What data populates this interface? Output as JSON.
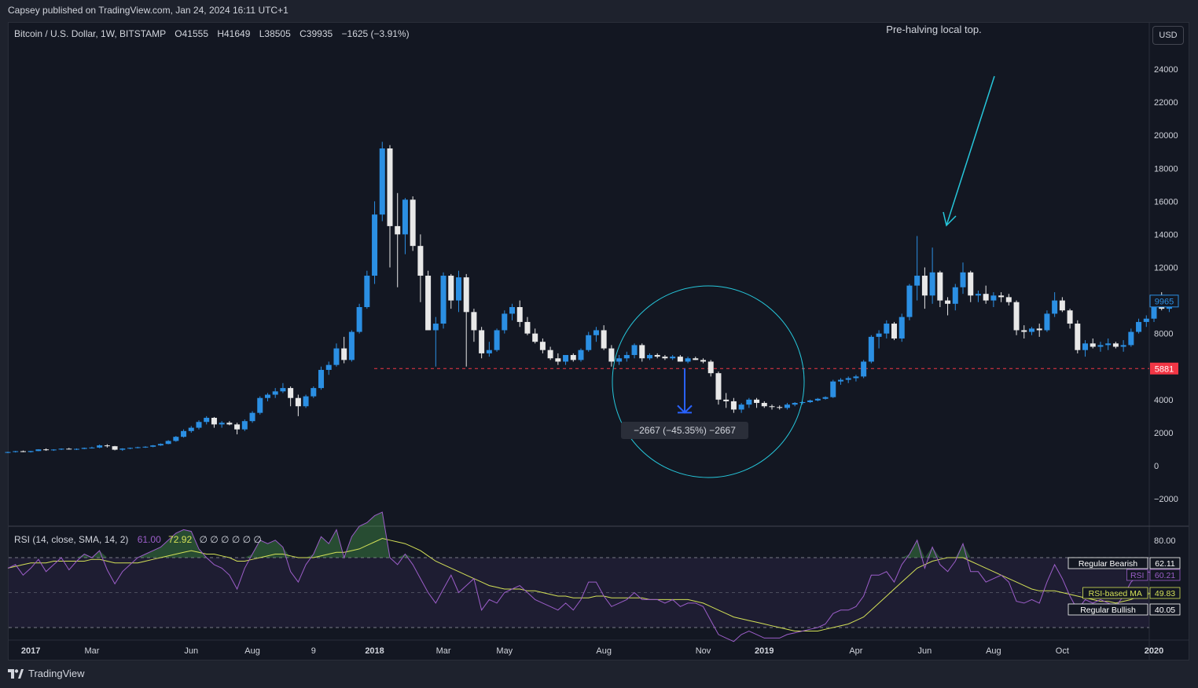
{
  "header": {
    "publisher": "Capsey published on TradingView.com, Jan 24, 2024 16:11 UTC+1"
  },
  "legend": {
    "symbol": "Bitcoin / U.S. Dollar, 1W, BITSTAMP",
    "open": "O41555",
    "high": "H41649",
    "low": "L38505",
    "close": "C39935",
    "change": "−1625 (−3.91%)"
  },
  "currency_button": "USD",
  "annotations": {
    "note": "Pre-halving local top.",
    "measure": "−2667 (−45.35%) −2667",
    "support_level": "5881",
    "last_price": "9965"
  },
  "rsi": {
    "title": "RSI (14, close, SMA, 14, 2)",
    "value": "61.00",
    "ma_value": "72.92",
    "empty_markers": "∅ ∅ ∅ ∅ ∅ ∅",
    "labels": [
      {
        "name": "Regular Bearish",
        "value": "62.11"
      },
      {
        "name": "RSI",
        "value": "60.21"
      },
      {
        "name": "RSI-based MA",
        "value": "49.83"
      },
      {
        "name": "Regular Bullish",
        "value": "40.05"
      }
    ],
    "axis_top": "80.00"
  },
  "footer": {
    "brand": "TradingView"
  },
  "colors": {
    "up": "#2b8fe3",
    "down": "#e8e8e8",
    "background": "#131722",
    "annotation": "#26c6da",
    "support": "#f23645",
    "rsi": "#9c5ec9",
    "rsi_ma": "#d4e157",
    "measure_arrow": "#2962ff"
  },
  "chart_data": {
    "type": "candlestick",
    "title": "Bitcoin / U.S. Dollar, 1W, BITSTAMP",
    "price_axis": {
      "ticks": [
        24000,
        22000,
        20000,
        18000,
        16000,
        14000,
        12000,
        10000,
        8000,
        6000,
        4000,
        2000,
        0,
        -2000
      ],
      "tick_labels": [
        "24000",
        "22000",
        "20000",
        "18000",
        "16000",
        "14000",
        "12000",
        "",
        "8000",
        "",
        "4000",
        "2000",
        "0",
        "−2000"
      ]
    },
    "time_axis": {
      "labels": [
        "2017",
        "Mar",
        "Jun",
        "Aug",
        "9",
        "2018",
        "Mar",
        "May",
        "Aug",
        "Nov",
        "2019",
        "Apr",
        "Jun",
        "Aug",
        "Oct",
        "2020"
      ],
      "label_week_index": [
        3,
        11,
        24,
        32,
        40,
        48,
        57,
        65,
        78,
        91,
        99,
        111,
        120,
        129,
        138,
        150
      ]
    },
    "ohlc": [
      [
        780,
        850,
        760,
        830
      ],
      [
        830,
        900,
        800,
        880
      ],
      [
        880,
        920,
        820,
        830
      ],
      [
        830,
        900,
        800,
        890
      ],
      [
        890,
        1000,
        880,
        990
      ],
      [
        990,
        1050,
        900,
        940
      ],
      [
        940,
        1000,
        900,
        980
      ],
      [
        980,
        1050,
        950,
        1030
      ],
      [
        1030,
        1080,
        980,
        1000
      ],
      [
        1000,
        1050,
        950,
        1020
      ],
      [
        1020,
        1100,
        1000,
        1080
      ],
      [
        1080,
        1150,
        1040,
        1100
      ],
      [
        1100,
        1280,
        1060,
        1230
      ],
      [
        1230,
        1300,
        1100,
        1180
      ],
      [
        1180,
        1200,
        930,
        970
      ],
      [
        970,
        1060,
        900,
        1040
      ],
      [
        1040,
        1100,
        1000,
        1080
      ],
      [
        1080,
        1150,
        1050,
        1120
      ],
      [
        1120,
        1180,
        1080,
        1150
      ],
      [
        1150,
        1250,
        1120,
        1230
      ],
      [
        1230,
        1350,
        1200,
        1320
      ],
      [
        1320,
        1550,
        1300,
        1500
      ],
      [
        1500,
        1800,
        1450,
        1750
      ],
      [
        1750,
        2200,
        1700,
        2100
      ],
      [
        2100,
        2400,
        2000,
        2300
      ],
      [
        2300,
        2750,
        2200,
        2650
      ],
      [
        2650,
        3000,
        2500,
        2900
      ],
      [
        2900,
        2950,
        2300,
        2500
      ],
      [
        2500,
        2700,
        2300,
        2600
      ],
      [
        2600,
        2700,
        2450,
        2500
      ],
      [
        2500,
        2600,
        1900,
        2200
      ],
      [
        2200,
        2800,
        2100,
        2700
      ],
      [
        2700,
        3300,
        2600,
        3200
      ],
      [
        3200,
        4200,
        3100,
        4100
      ],
      [
        4100,
        4400,
        3900,
        4300
      ],
      [
        4300,
        4700,
        4100,
        4500
      ],
      [
        4500,
        5000,
        4400,
        4700
      ],
      [
        4700,
        4800,
        3600,
        4100
      ],
      [
        4100,
        4300,
        3000,
        3600
      ],
      [
        3600,
        4300,
        3500,
        4200
      ],
      [
        4200,
        4800,
        4100,
        4700
      ],
      [
        4700,
        6000,
        4600,
        5800
      ],
      [
        5800,
        6300,
        5500,
        6100
      ],
      [
        6100,
        7400,
        6000,
        7100
      ],
      [
        7100,
        7800,
        6200,
        6400
      ],
      [
        6400,
        8200,
        6300,
        8100
      ],
      [
        8100,
        9800,
        8000,
        9600
      ],
      [
        9600,
        11800,
        9500,
        11500
      ],
      [
        11500,
        16000,
        11000,
        15200
      ],
      [
        15200,
        19600,
        14800,
        19200
      ],
      [
        19200,
        19400,
        12000,
        14500
      ],
      [
        14500,
        16500,
        10800,
        14000
      ],
      [
        14000,
        16200,
        12800,
        16100
      ],
      [
        16100,
        16300,
        13000,
        13300
      ],
      [
        13300,
        14000,
        9900,
        11500
      ],
      [
        11500,
        11800,
        9000,
        8200
      ],
      [
        8200,
        9000,
        6000,
        8600
      ],
      [
        8600,
        11700,
        8300,
        11500
      ],
      [
        11500,
        11600,
        9500,
        10000
      ],
      [
        10000,
        11800,
        9300,
        11400
      ],
      [
        11400,
        11600,
        6000,
        9300
      ],
      [
        9300,
        9500,
        7500,
        8200
      ],
      [
        8200,
        8400,
        6500,
        6800
      ],
      [
        6800,
        7500,
        6600,
        7000
      ],
      [
        7000,
        8300,
        6900,
        8200
      ],
      [
        8200,
        9400,
        8000,
        9200
      ],
      [
        9200,
        9800,
        8800,
        9600
      ],
      [
        9600,
        10000,
        8400,
        8700
      ],
      [
        8700,
        9000,
        7900,
        8000
      ],
      [
        8000,
        8300,
        7400,
        7500
      ],
      [
        7500,
        7700,
        6800,
        7000
      ],
      [
        7000,
        7200,
        6400,
        6500
      ],
      [
        6500,
        6800,
        6100,
        6300
      ],
      [
        6300,
        6700,
        6100,
        6700
      ],
      [
        6700,
        6800,
        6300,
        6400
      ],
      [
        6400,
        7100,
        6300,
        7000
      ],
      [
        7000,
        8100,
        6900,
        7900
      ],
      [
        7900,
        8400,
        7500,
        8200
      ],
      [
        8200,
        8500,
        7000,
        7100
      ],
      [
        7100,
        7300,
        6000,
        6300
      ],
      [
        6300,
        6700,
        6100,
        6500
      ],
      [
        6500,
        6900,
        6300,
        6700
      ],
      [
        6700,
        7400,
        6500,
        7300
      ],
      [
        7300,
        7400,
        6300,
        6500
      ],
      [
        6500,
        6800,
        6400,
        6700
      ],
      [
        6700,
        6800,
        6500,
        6600
      ],
      [
        6600,
        6700,
        6400,
        6500
      ],
      [
        6500,
        6700,
        6400,
        6600
      ],
      [
        6600,
        6700,
        6300,
        6300
      ],
      [
        6300,
        6600,
        6200,
        6500
      ],
      [
        6500,
        6600,
        6400,
        6400
      ],
      [
        6400,
        6500,
        6200,
        6300
      ],
      [
        6300,
        6400,
        5400,
        5600
      ],
      [
        5600,
        5700,
        3700,
        4000
      ],
      [
        4000,
        4400,
        3500,
        3900
      ],
      [
        3900,
        4100,
        3200,
        3400
      ],
      [
        3400,
        3800,
        3200,
        3700
      ],
      [
        3700,
        4100,
        3500,
        4000
      ],
      [
        4000,
        4100,
        3500,
        3800
      ],
      [
        3800,
        3900,
        3500,
        3600
      ],
      [
        3600,
        3700,
        3400,
        3550
      ],
      [
        3550,
        3650,
        3400,
        3500
      ],
      [
        3500,
        3800,
        3400,
        3700
      ],
      [
        3700,
        3850,
        3600,
        3800
      ],
      [
        3800,
        3900,
        3700,
        3850
      ],
      [
        3850,
        4000,
        3800,
        3950
      ],
      [
        3950,
        4100,
        3900,
        4050
      ],
      [
        4050,
        4200,
        4000,
        4150
      ],
      [
        4150,
        5200,
        4100,
        5100
      ],
      [
        5100,
        5300,
        4900,
        5200
      ],
      [
        5200,
        5400,
        5000,
        5300
      ],
      [
        5300,
        5500,
        5100,
        5400
      ],
      [
        5400,
        6400,
        5300,
        6300
      ],
      [
        6300,
        7900,
        6200,
        7800
      ],
      [
        7800,
        8200,
        7100,
        8000
      ],
      [
        8000,
        8800,
        7700,
        8600
      ],
      [
        8600,
        8700,
        7600,
        7700
      ],
      [
        7700,
        9200,
        7500,
        9000
      ],
      [
        9000,
        11000,
        8800,
        10900
      ],
      [
        10900,
        13900,
        10000,
        11500
      ],
      [
        11500,
        12000,
        9500,
        10300
      ],
      [
        10300,
        13200,
        9800,
        11700
      ],
      [
        11700,
        11800,
        9600,
        10000
      ],
      [
        10000,
        10200,
        9100,
        9800
      ],
      [
        9800,
        11000,
        9400,
        10800
      ],
      [
        10800,
        12300,
        10400,
        11700
      ],
      [
        11700,
        11800,
        9900,
        10300
      ],
      [
        10300,
        10600,
        9900,
        10400
      ],
      [
        10400,
        10900,
        9800,
        10000
      ],
      [
        10000,
        10500,
        9600,
        10300
      ],
      [
        10300,
        10500,
        9900,
        10200
      ],
      [
        10200,
        10400,
        9700,
        9900
      ],
      [
        9900,
        10000,
        7900,
        8200
      ],
      [
        8200,
        8500,
        7700,
        8100
      ],
      [
        8100,
        8400,
        7900,
        8300
      ],
      [
        8300,
        8600,
        7800,
        8200
      ],
      [
        8200,
        9400,
        8100,
        9200
      ],
      [
        9200,
        10500,
        9000,
        10000
      ],
      [
        10000,
        10200,
        9300,
        9400
      ],
      [
        9400,
        9500,
        8300,
        8600
      ],
      [
        8600,
        8800,
        6800,
        7000
      ],
      [
        7000,
        7600,
        6600,
        7400
      ],
      [
        7400,
        7700,
        7100,
        7200
      ],
      [
        7200,
        7500,
        6900,
        7300
      ],
      [
        7300,
        7700,
        7000,
        7400
      ],
      [
        7400,
        7500,
        7100,
        7200
      ],
      [
        7200,
        7600,
        6900,
        7300
      ],
      [
        7300,
        8300,
        7200,
        8100
      ],
      [
        8100,
        8900,
        8000,
        8700
      ],
      [
        8700,
        9100,
        8400,
        8900
      ],
      [
        8900,
        9700,
        8700,
        9600
      ],
      [
        9600,
        10500,
        9400,
        9500
      ],
      [
        9500,
        10100,
        9300,
        9965
      ]
    ],
    "rsi_series": [
      64,
      66,
      60,
      64,
      69,
      62,
      66,
      70,
      63,
      68,
      72,
      70,
      74,
      63,
      55,
      62,
      66,
      70,
      72,
      74,
      76,
      80,
      84,
      86,
      85,
      75,
      70,
      66,
      64,
      60,
      52,
      64,
      72,
      80,
      78,
      80,
      76,
      62,
      56,
      66,
      72,
      82,
      78,
      86,
      70,
      82,
      88,
      90,
      94,
      96,
      70,
      66,
      72,
      66,
      58,
      50,
      44,
      52,
      60,
      50,
      54,
      58,
      40,
      46,
      44,
      50,
      52,
      54,
      50,
      46,
      44,
      42,
      40,
      44,
      40,
      46,
      56,
      56,
      48,
      42,
      44,
      46,
      50,
      46,
      46,
      46,
      44,
      46,
      42,
      44,
      44,
      42,
      34,
      26,
      24,
      22,
      26,
      28,
      26,
      24,
      24,
      24,
      26,
      27,
      28,
      29,
      30,
      32,
      38,
      40,
      40,
      42,
      48,
      60,
      60,
      62,
      56,
      66,
      72,
      80,
      64,
      76,
      66,
      62,
      68,
      78,
      62,
      62,
      56,
      58,
      60,
      56,
      45,
      44,
      46,
      44,
      56,
      66,
      58,
      48,
      40,
      46,
      44,
      46,
      44,
      42,
      48,
      56,
      60,
      62,
      61
    ],
    "rsi_ma_series": [
      64,
      65,
      66,
      67,
      67,
      67,
      68,
      68,
      68,
      68,
      68,
      69,
      69,
      68,
      67,
      67,
      67,
      67,
      68,
      69,
      70,
      71,
      72,
      73,
      74,
      73,
      72,
      72,
      71,
      70,
      68,
      68,
      69,
      70,
      71,
      72,
      72,
      71,
      70,
      70,
      70,
      71,
      72,
      73,
      73,
      74,
      75,
      77,
      79,
      81,
      80,
      79,
      78,
      76,
      74,
      71,
      68,
      66,
      64,
      62,
      60,
      58,
      56,
      54,
      53,
      52,
      52,
      52,
      51,
      51,
      50,
      49,
      48,
      48,
      47,
      47,
      47,
      48,
      48,
      47,
      47,
      47,
      47,
      47,
      46,
      46,
      46,
      46,
      46,
      46,
      45,
      44,
      42,
      40,
      38,
      36,
      35,
      34,
      33,
      32,
      31,
      30,
      29,
      28,
      28,
      28,
      28,
      29,
      30,
      31,
      32,
      34,
      36,
      40,
      44,
      48,
      52,
      56,
      60,
      64,
      66,
      68,
      69,
      70,
      70,
      70,
      68,
      66,
      64,
      62,
      60,
      58,
      56,
      54,
      52,
      51,
      51,
      51,
      50,
      49,
      48,
      47,
      46,
      45,
      45,
      44,
      45,
      46,
      48,
      49,
      50
    ],
    "rsi_axis": {
      "range": [
        0,
        100
      ],
      "bands": [
        30,
        50,
        70
      ]
    },
    "support_price": 5881,
    "measure": {
      "from": 5881,
      "to": 3214
    }
  }
}
